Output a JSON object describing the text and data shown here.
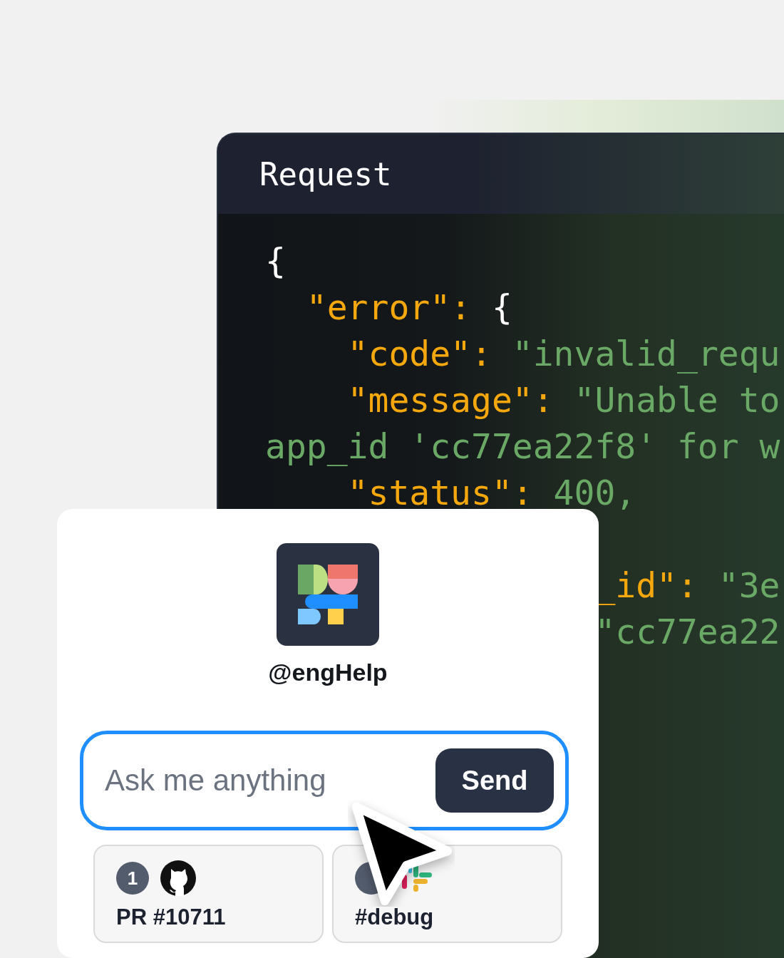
{
  "code_panel": {
    "title": "Request",
    "lines": [
      {
        "segments": [
          {
            "kind": "punct",
            "text": "{"
          }
        ]
      },
      {
        "segments": [
          {
            "kind": "key",
            "text": "  \"error\":"
          },
          {
            "kind": "punct",
            "text": " {"
          }
        ]
      },
      {
        "segments": [
          {
            "kind": "key",
            "text": "    \"code\":"
          },
          {
            "kind": "string",
            "text": " \"invalid_requ"
          }
        ]
      },
      {
        "segments": [
          {
            "kind": "key",
            "text": "    \"message\":"
          },
          {
            "kind": "string",
            "text": " \"Unable to"
          }
        ]
      },
      {
        "segments": [
          {
            "kind": "string",
            "text": "app_id 'cc77ea22f8' for w"
          }
        ]
      },
      {
        "segments": [
          {
            "kind": "key",
            "text": "    \"status\":"
          },
          {
            "kind": "number",
            "text": " 400,"
          }
        ]
      },
      {
        "gap_before": true,
        "segments": [
          {
            "kind": "key",
            "text": "                _id\":"
          },
          {
            "kind": "string",
            "text": " \"3e"
          }
        ]
      },
      {
        "segments": [
          {
            "kind": "string",
            "text": "                \"cc77ea22"
          }
        ]
      }
    ]
  },
  "assistant_card": {
    "handle": "@engHelp",
    "input": {
      "placeholder": "Ask me anything",
      "button": "Send"
    },
    "sources": [
      {
        "kind": "github",
        "count": "1",
        "label": "PR #10711"
      },
      {
        "kind": "slack",
        "label": "#debug"
      }
    ]
  }
}
